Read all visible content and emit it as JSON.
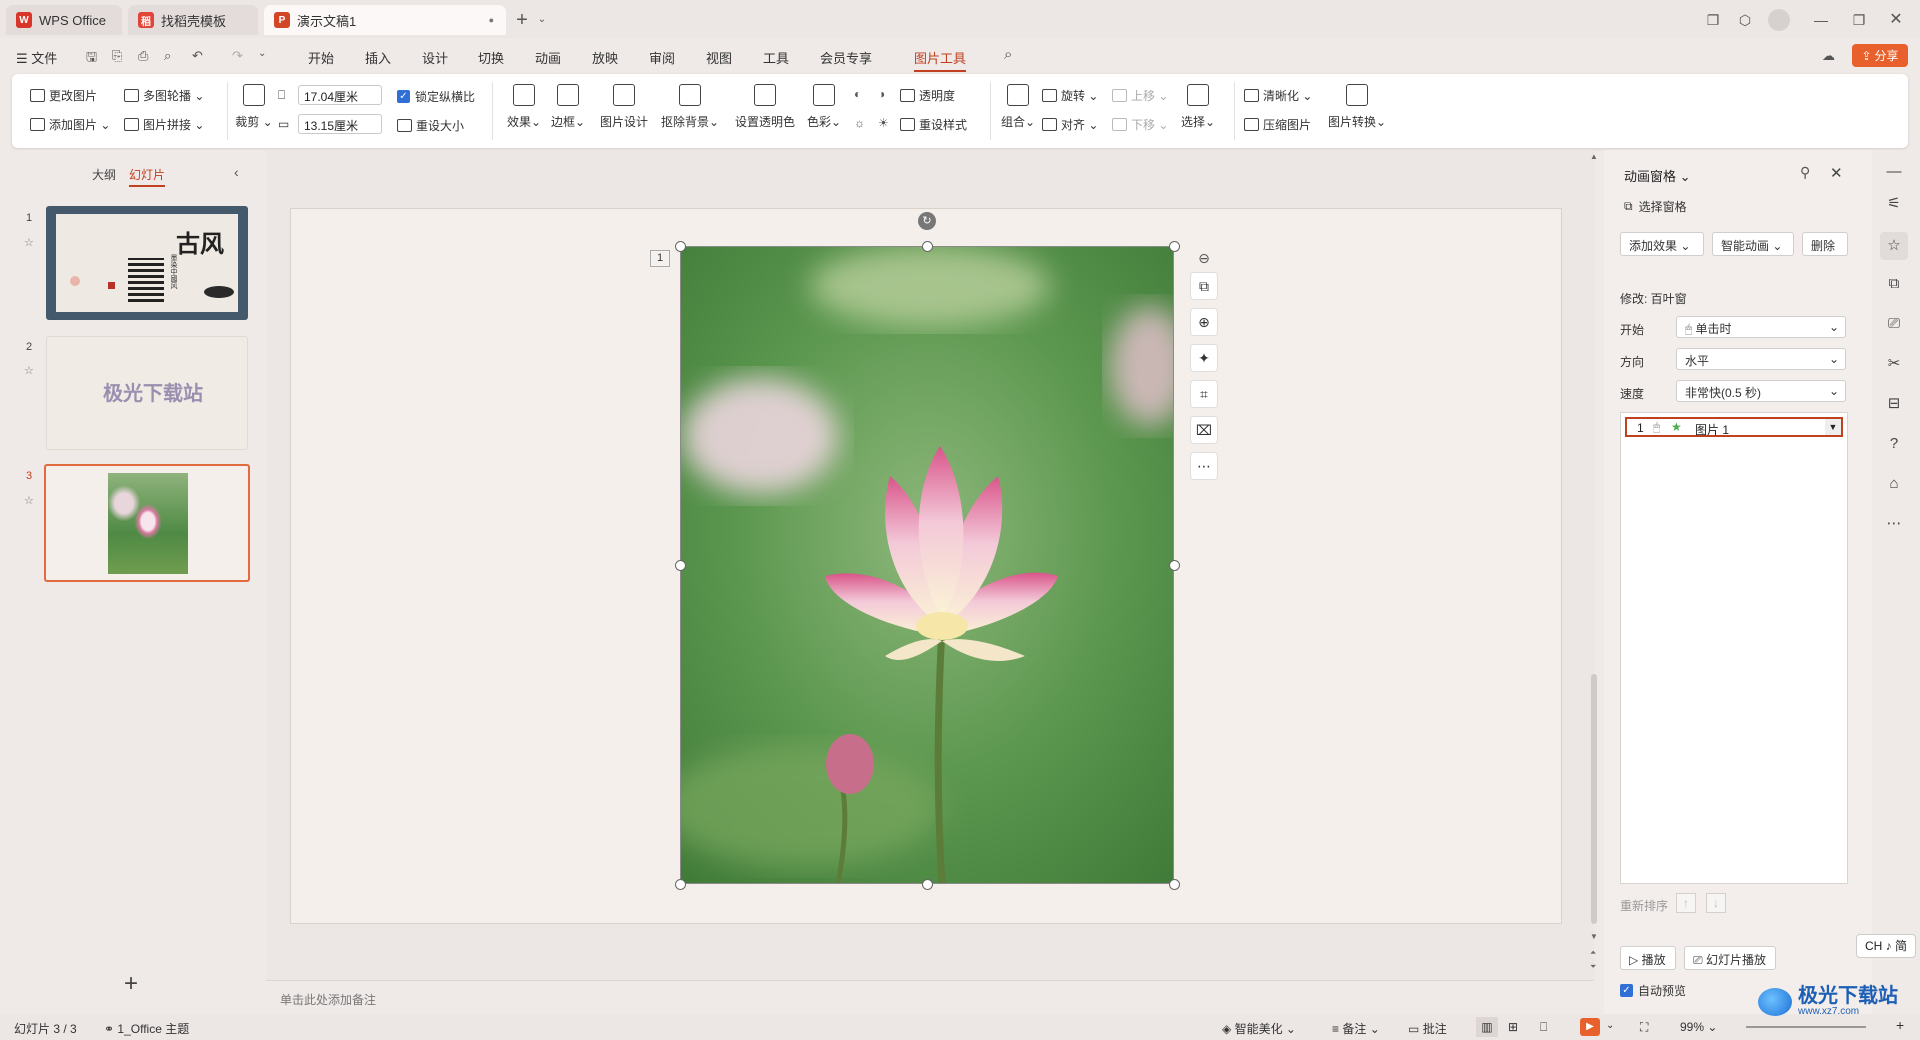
{
  "tabs": [
    {
      "label": "WPS Office"
    },
    {
      "label": "找稻壳模板"
    },
    {
      "label": "演示文稿1"
    }
  ],
  "menu": {
    "file": "文件",
    "items": [
      "开始",
      "插入",
      "设计",
      "切换",
      "动画",
      "放映",
      "审阅",
      "视图",
      "工具",
      "会员专享",
      "图片工具"
    ],
    "active": "图片工具",
    "share": "分享"
  },
  "ribbon": {
    "change_pic": "更改图片",
    "multi_carousel": "多图轮播",
    "add_pic": "添加图片",
    "pic_collage": "图片拼接",
    "crop": "裁剪",
    "width": "17.04厘米",
    "height": "13.15厘米",
    "lock_ratio": "锁定纵横比",
    "reset_size": "重设大小",
    "effects": "效果",
    "border": "边框",
    "pic_design": "图片设计",
    "remove_bg": "抠除背景",
    "set_transparent": "设置透明色",
    "color": "色彩",
    "transparency": "透明度",
    "reset_style": "重设样式",
    "group": "组合",
    "rotate": "旋转",
    "align": "对齐",
    "move_up": "上移",
    "move_down": "下移",
    "select": "选择",
    "clarify": "清晰化",
    "compress": "压缩图片",
    "convert": "图片转换"
  },
  "left_panel": {
    "outline_tab": "大纲",
    "slides_tab": "幻灯片",
    "slides": [
      {
        "num": "1",
        "title": "古风",
        "subtitle": "墨染中國风"
      },
      {
        "num": "2",
        "text": "极光下载站"
      },
      {
        "num": "3"
      }
    ],
    "add": "+"
  },
  "canvas": {
    "anim_marker": "1",
    "notes_placeholder": "单击此处添加备注"
  },
  "anim_pane": {
    "title": "动画窗格",
    "selection_pane": "选择窗格",
    "add_effect": "添加效果",
    "smart_anim": "智能动画",
    "delete": "删除",
    "modify": "修改: 百叶窗",
    "start_label": "开始",
    "start_value": "单击时",
    "direction_label": "方向",
    "direction_value": "水平",
    "speed_label": "速度",
    "speed_value": "非常快(0.5 秒)",
    "item": {
      "index": "1",
      "name": "图片 1"
    },
    "reorder": "重新排序",
    "play": "播放",
    "slideshow": "幻灯片播放",
    "autopreview": "自动预览"
  },
  "ime": "CH ♪ 简",
  "status": {
    "slide_count": "幻灯片 3 / 3",
    "theme": "1_Office 主题",
    "beautify": "智能美化",
    "notes": "备注",
    "comments": "批注",
    "zoom": "99%"
  },
  "watermark": {
    "text": "极光下载站",
    "url": "www.xz7.com"
  },
  "colors": {
    "accent": "#c0411f",
    "share": "#e8612c",
    "ppt_red": "#d24625"
  }
}
